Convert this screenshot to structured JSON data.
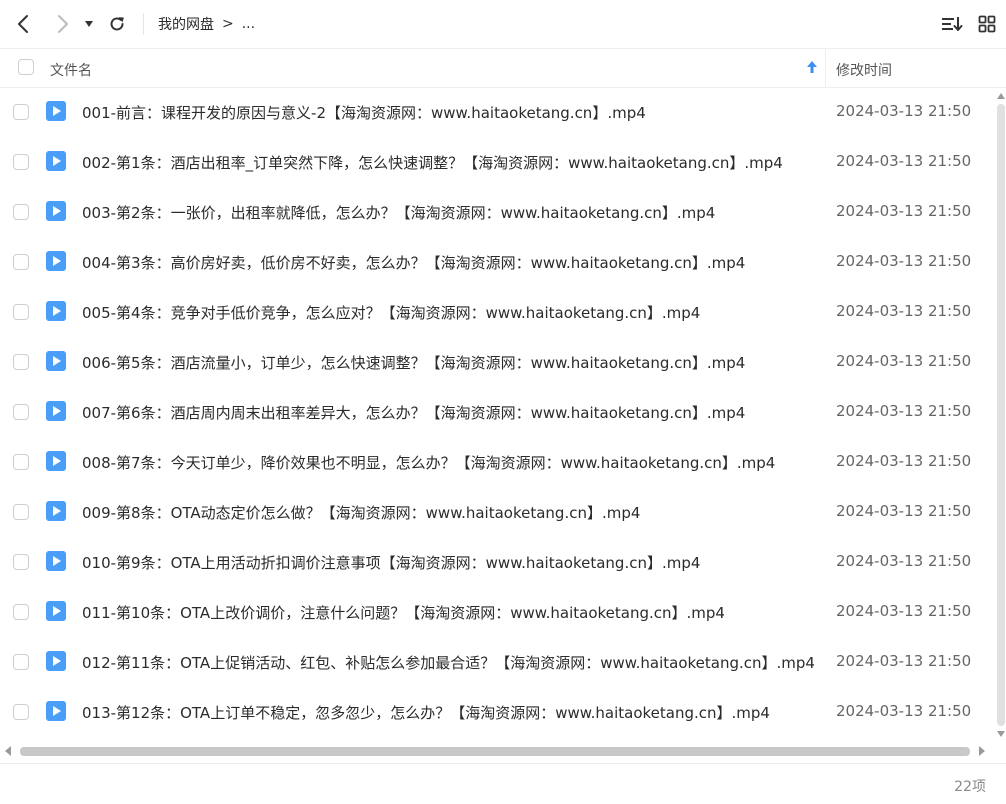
{
  "breadcrumb": {
    "root": "我的网盘",
    "separator": ">",
    "more": "..."
  },
  "header": {
    "name_label": "文件名",
    "time_label": "修改时间"
  },
  "files": [
    {
      "name": "001-前言：课程开发的原因与意义-2【海淘资源网：www.haitaoketang.cn】.mp4",
      "time": "2024-03-13 21:50"
    },
    {
      "name": "002-第1条：酒店出租率_订单突然下降，怎么快速调整？【海淘资源网：www.haitaoketang.cn】.mp4",
      "time": "2024-03-13 21:50"
    },
    {
      "name": "003-第2条：一张价，出租率就降低，怎么办？【海淘资源网：www.haitaoketang.cn】.mp4",
      "time": "2024-03-13 21:50"
    },
    {
      "name": "004-第3条：高价房好卖，低价房不好卖，怎么办？【海淘资源网：www.haitaoketang.cn】.mp4",
      "time": "2024-03-13 21:50"
    },
    {
      "name": "005-第4条：竞争对手低价竞争，怎么应对？【海淘资源网：www.haitaoketang.cn】.mp4",
      "time": "2024-03-13 21:50"
    },
    {
      "name": "006-第5条：酒店流量小，订单少，怎么快速调整？【海淘资源网：www.haitaoketang.cn】.mp4",
      "time": "2024-03-13 21:50"
    },
    {
      "name": "007-第6条：酒店周内周末出租率差异大，怎么办？【海淘资源网：www.haitaoketang.cn】.mp4",
      "time": "2024-03-13 21:50"
    },
    {
      "name": "008-第7条：今天订单少，降价效果也不明显，怎么办？【海淘资源网：www.haitaoketang.cn】.mp4",
      "time": "2024-03-13 21:50"
    },
    {
      "name": "009-第8条：OTA动态定价怎么做？【海淘资源网：www.haitaoketang.cn】.mp4",
      "time": "2024-03-13 21:50"
    },
    {
      "name": "010-第9条：OTA上用活动折扣调价注意事项【海淘资源网：www.haitaoketang.cn】.mp4",
      "time": "2024-03-13 21:50"
    },
    {
      "name": "011-第10条：OTA上改价调价，注意什么问题？【海淘资源网：www.haitaoketang.cn】.mp4",
      "time": "2024-03-13 21:50"
    },
    {
      "name": "012-第11条：OTA上促销活动、红包、补贴怎么参加最合适？【海淘资源网：www.haitaoketang.cn】.mp4",
      "time": "2024-03-13 21:50"
    },
    {
      "name": "013-第12条：OTA上订单不稳定，忽多忽少，怎么办？【海淘资源网：www.haitaoketang.cn】.mp4",
      "time": "2024-03-13 21:50"
    }
  ],
  "footer": {
    "count": "22项"
  },
  "colors": {
    "accent": "#3d8ff5",
    "file_icon": "#4a9ef7",
    "text": "#2b2b2b",
    "muted": "#8a8a8a"
  },
  "icons": {
    "back": "chevron-left-icon",
    "forward": "chevron-right-icon",
    "dropdown": "caret-down-icon",
    "refresh": "refresh-icon",
    "sort": "sort-list-icon",
    "grid": "grid-view-icon",
    "file": "video-file-icon",
    "sort_asc": "arrow-up-icon"
  }
}
